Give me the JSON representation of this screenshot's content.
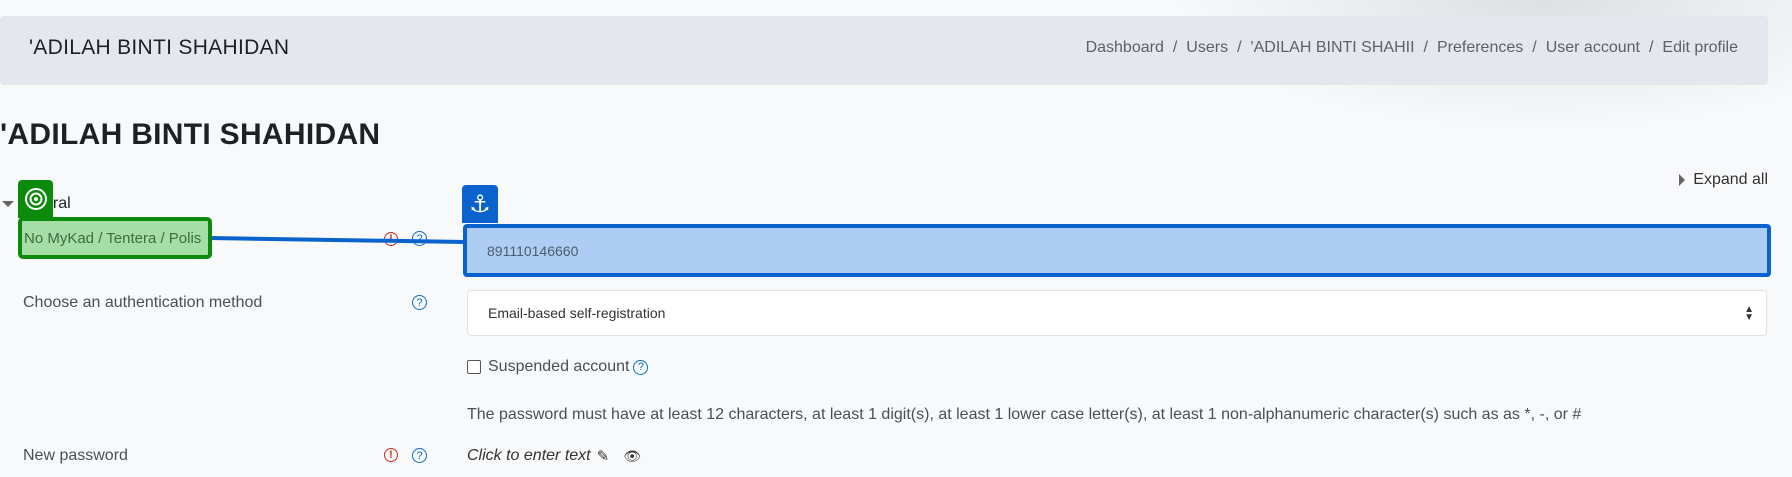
{
  "header": {
    "title": "'ADILAH BINTI SHAHIDAN",
    "breadcrumb": [
      "Dashboard",
      "Users",
      "'ADILAH BINTI SHAHII",
      "Preferences",
      "User account",
      "Edit profile"
    ],
    "separator": "/"
  },
  "page_title": "'ADILAH BINTI SHAHIDAN",
  "expand_all": "Expand all",
  "section": {
    "label": "General",
    "label_visible": "eral"
  },
  "fields": {
    "idnumber": {
      "label": "No MyKad / Tentera / Polis",
      "value": "891110146660"
    },
    "auth": {
      "label": "Choose an authentication method",
      "selected": "Email-based self-registration"
    },
    "suspended": {
      "label": "Suspended account"
    },
    "password": {
      "hint": "The password must have at least 12 characters, at least 1 digit(s), at least 1 lower case letter(s), at least 1 non-alphanumeric character(s) such as as *, -, or #",
      "label": "New password",
      "edit_text": "Click to enter text"
    }
  },
  "icons": {
    "required": "exclamation-circle-icon",
    "help": "question-circle-icon",
    "pencil": "pencil-icon",
    "eye": "eye-icon",
    "target": "target-icon",
    "anchor": "anchor-icon"
  },
  "colors": {
    "target_green": "#0c8a0c",
    "anchor_blue": "#0a63cc",
    "required_red": "#ca3120",
    "help_blue": "#0f6cbf"
  }
}
